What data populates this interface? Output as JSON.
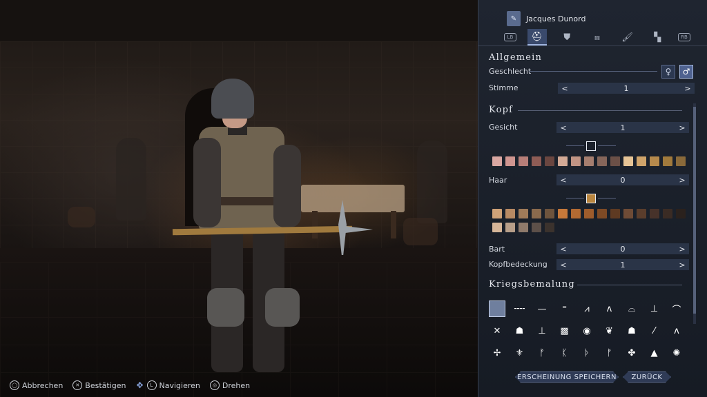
{
  "character": {
    "name": "Jacques Dunord"
  },
  "tabs": [
    {
      "id": "lb",
      "label": "LB",
      "icon": "lb-button-icon"
    },
    {
      "id": "head",
      "label": "",
      "icon": "helmet-icon",
      "active": true
    },
    {
      "id": "armor",
      "label": "",
      "icon": "armor-icon"
    },
    {
      "id": "legs",
      "label": "",
      "icon": "legs-icon"
    },
    {
      "id": "paint",
      "label": "",
      "icon": "brush-icon"
    },
    {
      "id": "pattern",
      "label": "",
      "icon": "checker-icon"
    },
    {
      "id": "rb",
      "label": "RB",
      "icon": "rb-button-icon"
    }
  ],
  "general": {
    "title": "Allgemein",
    "gender_label": "Geschlecht",
    "gender_female_symbol": "♀",
    "gender_male_symbol": "♂",
    "gender_selected": "male",
    "voice_label": "Stimme",
    "voice_value": "1"
  },
  "head": {
    "title": "Kopf",
    "face_label": "Gesicht",
    "face_value": "1",
    "skin_colors": [
      "#d9a7a2",
      "#cf9590",
      "#b77e78",
      "#8e5c55",
      "#6a4640",
      "#d3aa96",
      "#c19484",
      "#a57e6f",
      "#86665a",
      "#6b5047",
      "#e6c496",
      "#d0a46a",
      "#b68a4c",
      "#a17a3c",
      "#8a6a3a"
    ],
    "hair_label": "Haar",
    "hair_value": "0",
    "hair_colors": [
      "#cfa278",
      "#b88a63",
      "#a07b59",
      "#8a6a4d",
      "#6e543d",
      "#c7793a",
      "#b36a32",
      "#9e5c2c",
      "#7e4a25",
      "#5e3a22",
      "#6e4b36",
      "#5a3d2c",
      "#47322a",
      "#3a2b24",
      "#2a211d",
      "#d6b699",
      "#b79e89",
      "#8f7a6b",
      "#5d5049",
      "#3b322d"
    ],
    "beard_label": "Bart",
    "beard_value": "0",
    "headwear_label": "Kopfbedeckung",
    "headwear_value": "1"
  },
  "warpaint": {
    "title": "Kriegsbemalung",
    "patterns": [
      "empty",
      "╌╌",
      "—",
      "⁼",
      "⩘",
      "ᴧ",
      "⌓",
      "⊥",
      "⌒",
      "✕",
      "☗",
      "⊥",
      "▩",
      "◉",
      "❦",
      "☗",
      "⁄",
      "ᴧ",
      "✢",
      "⚜",
      "ᚠ",
      "ᛕ",
      "ᚦ",
      "ᚠ",
      "✤",
      "▲",
      "✺"
    ]
  },
  "footer": {
    "save_label": "ERSCHEINUNG SPEICHERN",
    "back_label": "ZURÜCK"
  },
  "controls": {
    "cancel": {
      "icon": "circle-button-icon",
      "glyph": "◯",
      "label": "Abbrechen"
    },
    "confirm": {
      "icon": "cross-button-icon",
      "glyph": "✕",
      "label": "Bestätigen"
    },
    "navigate": {
      "icon": "dpad-left-stick-icon",
      "glyph": "✥",
      "stick": "L",
      "label": "Navigieren"
    },
    "rotate": {
      "icon": "right-stick-icon",
      "glyph": "◎",
      "label": "Drehen"
    }
  }
}
